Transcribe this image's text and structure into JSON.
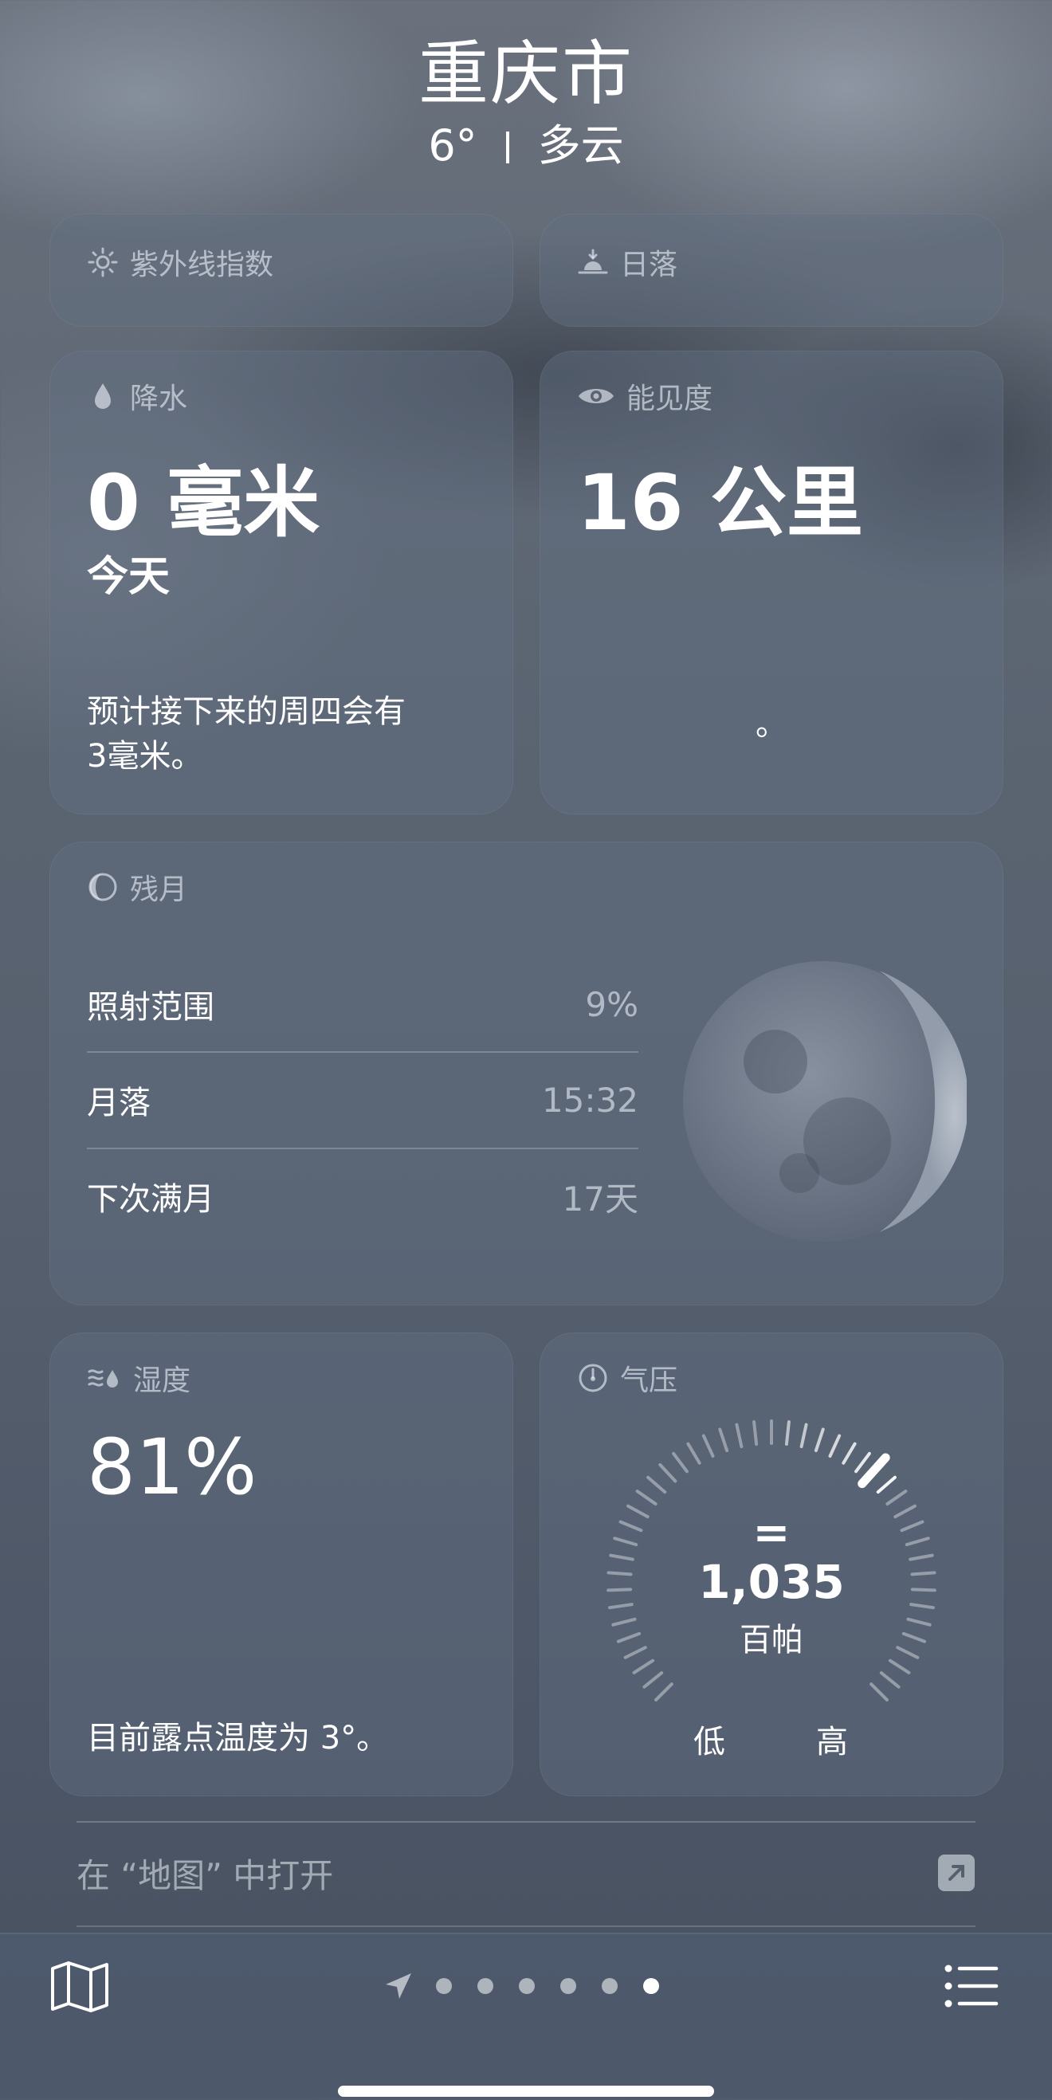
{
  "header": {
    "city": "重庆市",
    "temperature": "6°",
    "condition": "多云"
  },
  "uv_card": {
    "title": "紫外线指数"
  },
  "sunset_card": {
    "title": "日落"
  },
  "precip_card": {
    "title": "降水",
    "value": "0 毫米",
    "period": "今天",
    "note_line1": "预计接下来的周四会有",
    "note_line2": "3毫米。"
  },
  "visibility_card": {
    "title": "能见度",
    "value": "16 公里",
    "note": "。"
  },
  "moon_card": {
    "title": "残月",
    "rows": [
      {
        "label": "照射范围",
        "value": "9%"
      },
      {
        "label": "月落",
        "value": "15:32"
      },
      {
        "label": "下次满月",
        "value": "17天"
      }
    ],
    "illumination": 0.09
  },
  "humidity_card": {
    "title": "湿度",
    "value": "81%",
    "note": "目前露点温度为 3°。"
  },
  "pressure_card": {
    "title": "气压",
    "trend_symbol": "=",
    "value": "1,035",
    "unit": "百帕",
    "low_label": "低",
    "high_label": "高"
  },
  "maps_link": {
    "label": "在 “地图” 中打开"
  },
  "tab_bar": {
    "page_count": 7,
    "active_page": 7,
    "icons": [
      "map-icon",
      "location-arrow-icon",
      "list-icon"
    ]
  },
  "colors": {
    "card_bg": "#62708470",
    "accent": "#ffffff",
    "secondary_text": "#ebf0f89e"
  }
}
